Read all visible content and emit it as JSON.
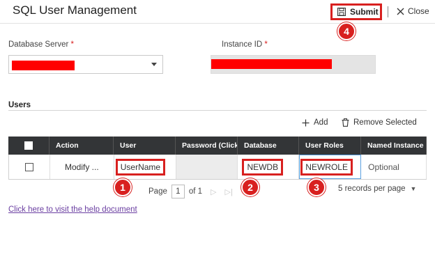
{
  "header": {
    "title": "SQL User Management",
    "submit_label": "Submit",
    "close_label": "Close"
  },
  "form": {
    "database_server_label": "Database Server",
    "instance_id_label": "Instance ID",
    "required_marker": "*"
  },
  "users": {
    "section_title": "Users",
    "add_label": "Add",
    "remove_label": "Remove Selected",
    "columns": [
      "Action",
      "User",
      "Password (Click to",
      "Database",
      "User Roles",
      "Named Instance"
    ],
    "rows": [
      {
        "action": "Modify ...",
        "user": "UserName",
        "password": "",
        "database": "NEWDB",
        "user_roles": "NEWROLE",
        "named_instance": "Optional"
      }
    ]
  },
  "pagination": {
    "page_label": "Page",
    "current_page": "1",
    "of_label": "of 1",
    "per_page": "5 records per page"
  },
  "help": {
    "link_text": "Click here to visit the help document"
  },
  "annotations": [
    "1",
    "2",
    "3",
    "4"
  ],
  "colors": {
    "highlight": "#d8201f",
    "grid_header": "#333537",
    "link": "#6a3ea1",
    "redaction": "#ff0000"
  },
  "icons": [
    "save-icon",
    "close-icon",
    "chevron-down-icon",
    "plus-icon",
    "trash-icon",
    "next-page-icon",
    "last-page-icon",
    "dropdown-caret-icon"
  ]
}
